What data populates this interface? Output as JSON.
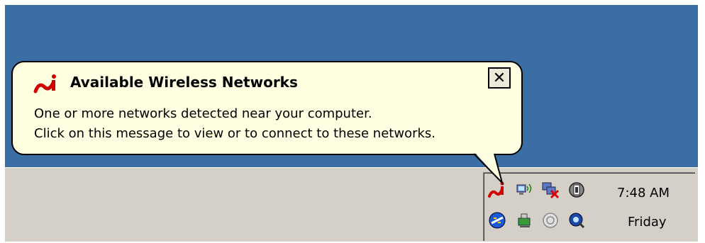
{
  "balloon": {
    "title": "Available Wireless Networks",
    "line1": "One or more networks detected near your computer.",
    "line2": "Click on this message to view or to connect to these networks.",
    "close_glyph": "✕",
    "icon": "wireless-utility-logo-icon"
  },
  "tray": {
    "icons_row1": [
      "wireless-utility-icon",
      "wireless-connection-icon",
      "network-disconnected-icon",
      "security-shield-icon"
    ],
    "icons_row2": [
      "network-adapter-icon",
      "hardware-icon",
      "volume-icon",
      "search-icon"
    ]
  },
  "clock": {
    "time": "7:48 AM",
    "day": "Friday"
  },
  "colors": {
    "desktop": "#3a6ea5",
    "balloon_bg": "#ffffe1",
    "taskbar": "#d4d0c8"
  }
}
